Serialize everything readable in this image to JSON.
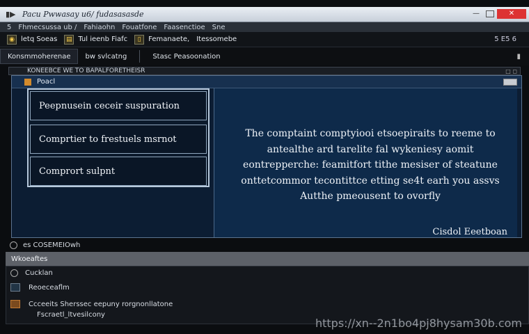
{
  "window": {
    "title": "Pacu Pwwasay u6/  fudasasasde",
    "close_label": "✕",
    "maximize_label": "",
    "minimize_label": "—"
  },
  "menubar": {
    "items": [
      "5",
      "Fhmecsussa ub /",
      "Fahiaohn",
      "Fouatfone",
      "Faasenctioe",
      "Sne"
    ]
  },
  "toolbar": {
    "items": [
      {
        "label": "letq Soeas",
        "icon": "lock-icon"
      },
      {
        "label": "Tul ieenb  Fiafc",
        "icon": "folder-icon"
      },
      {
        "label": "Femanaete,",
        "icon": "page-icon"
      },
      {
        "label": "Itessomebe",
        "icon": "gear-icon"
      }
    ],
    "right_value": "5 E5  6"
  },
  "tabs": {
    "items": [
      "Konsmmoherenae",
      "bw svlcatng",
      "Stasc Peasoonation"
    ]
  },
  "breadcrumb": {
    "text": "KONEEBCE WE TO BAPALFORETHEISR",
    "controls": "□ ◻"
  },
  "dialog": {
    "header_title": "Poacl",
    "options": [
      "Peepnusein ceceir suspuration",
      "Comprtier to frestuels msrnot",
      "Comprort sulpnt"
    ],
    "message": "The comptaint comptyiooi etsoepiraits to reeme to antealthe ard tarelite fal wykeniesy aomit eontrepperche: feamitfort tithe mesiser of steatune onttetcommor tecontittce etting se4t earh you assvs Autthe pmeousent to ovorfly",
    "signature": "Cisdol Eeetboan"
  },
  "statusline": {
    "text": "es COSEMEIOwh"
  },
  "lower": {
    "header": "Wkoeaftes",
    "rows": [
      {
        "label": "Cucklan",
        "icon": "circle-icon"
      },
      {
        "label": "Reoeceaflm",
        "icon": "monitor-icon"
      },
      {
        "label": "Ccceeits Sherssec eepuny rorgnonllatone",
        "icon": "warning-icon"
      }
    ],
    "sub": "Fscraetl_ltvesilcony"
  },
  "watermark": "https://xn--2n1bo4pj8hysam30b.com"
}
